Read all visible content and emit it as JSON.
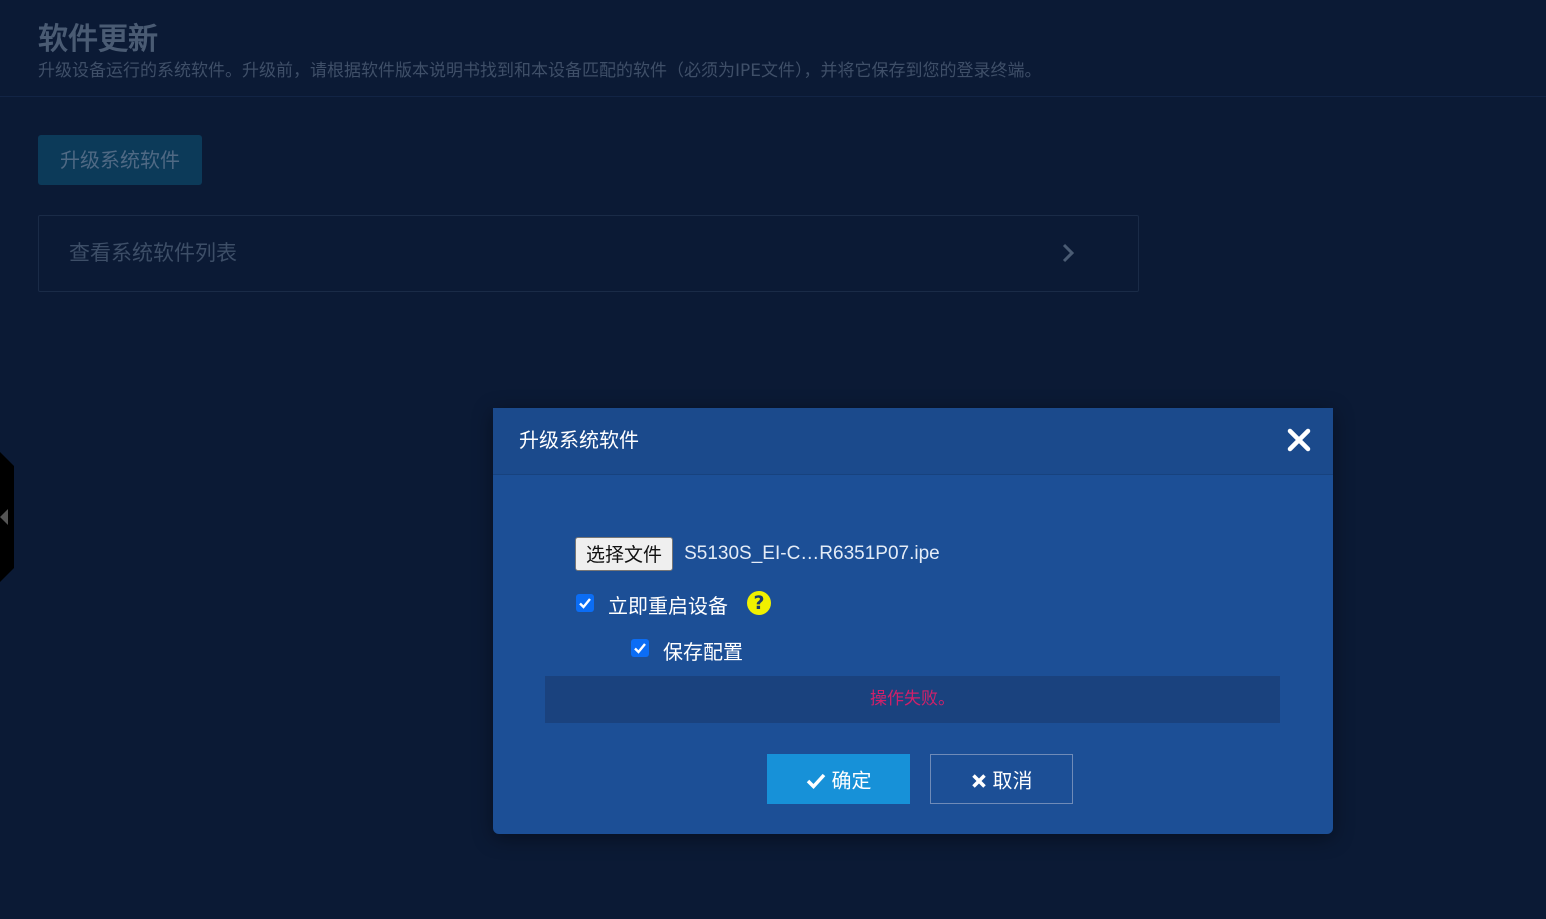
{
  "page": {
    "title": "软件更新",
    "description": "升级设备运行的系统软件。升级前，请根据软件版本说明书找到和本设备匹配的软件（必须为IPE文件），并将它保存到您的登录终端。"
  },
  "actions": {
    "upgrade_button_label": "升级系统软件"
  },
  "software_list": {
    "label": "查看系统软件列表",
    "icon": "chevron-right-icon"
  },
  "dialog": {
    "title": "升级系统软件",
    "close_icon": "close-icon",
    "file_picker": {
      "button_label": "选择文件",
      "file_name": "S5130S_EI-C…R6351P07.ipe"
    },
    "reboot_option": {
      "label": "立即重启设备",
      "checked": true,
      "help_icon": "help-icon",
      "help_symbol": "?"
    },
    "save_config_option": {
      "label": "保存配置",
      "checked": true
    },
    "error_message": "操作失败。",
    "confirm_button_label": "确定",
    "cancel_button_label": "取消"
  },
  "colors": {
    "page_background": "#0b1a35",
    "dialog_background": "#1c4f96",
    "primary_button": "#1791d8",
    "error_text": "#d0206a",
    "help_icon": "#f0f000",
    "checkbox": "#0b6df5"
  }
}
